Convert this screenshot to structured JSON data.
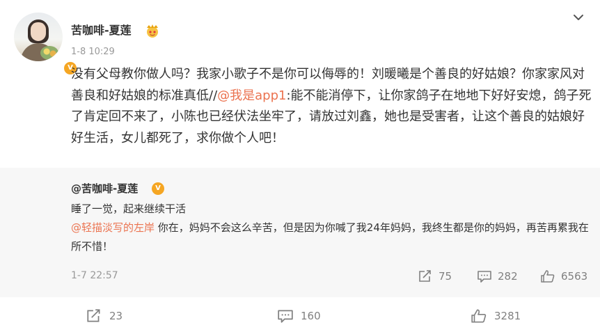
{
  "post": {
    "username": "苦咖啡-夏莲",
    "time": "1-8 10:29",
    "text_before_mention": "没有父母教你做人吗？我家小歌子不是你可以侮辱的！刘暖曦是个善良的好姑娘？你家家风对善良和好姑娘的标准真低//",
    "mention": "@我是app1",
    "text_after_mention": ":能不能消停下，让你家鸽子在地地下好好安熄，鸽子死了肯定回不来了，小陈也已经伏法坐牢了，请放过刘鑫，她也是受害者，让这个善良的姑娘好好生活，女儿都死了，求你做个人吧！",
    "reposts": "23",
    "comments": "160",
    "likes": "3281"
  },
  "repost": {
    "username": "@苦咖啡-夏莲",
    "line1": "睡了一觉，起来继续干活",
    "mention": "@轻描淡写的左岸",
    "text_after_mention": " 你在，妈妈不会这么辛苦，但是因为你喊了我24年妈妈，我终生都是你的妈妈，再苦再累我在所不惜！",
    "time": "1-7 22:57",
    "reposts": "75",
    "comments": "282",
    "likes": "6563"
  },
  "icons": {
    "verified": "verified-badge-icon",
    "crown": "crown-emoji-icon",
    "menu": "chevron-down-icon",
    "repost": "repost-icon",
    "comment": "comment-icon",
    "like": "thumbs-up-icon"
  },
  "colors": {
    "mention": "#eb7350",
    "badge": "#f5a623",
    "muted": "#808080",
    "repost_bg": "#f7f7f7"
  }
}
